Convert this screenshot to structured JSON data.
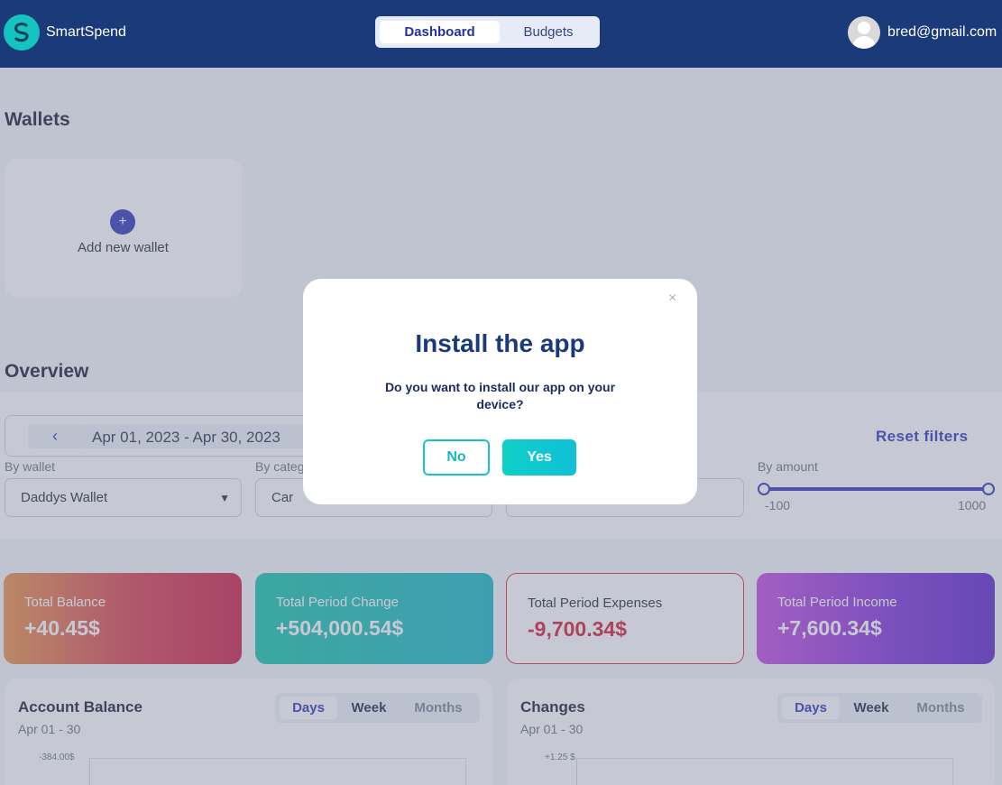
{
  "header": {
    "brand": "SmartSpend",
    "tabs": [
      {
        "label": "Dashboard",
        "active": true
      },
      {
        "label": "Budgets",
        "active": false
      }
    ],
    "user_email": "bred@gmail.com",
    "logo_icon": "s-logo-icon",
    "avatar_icon": "user-avatar-icon"
  },
  "wallets": {
    "title": "Wallets",
    "add_label": "Add new wallet",
    "add_icon": "plus-icon"
  },
  "overview": {
    "title": "Overview",
    "date_range": "Apr 01, 2023 - Apr 30, 2023",
    "prev_icon": "chevron-left-icon",
    "reset_label": "Reset filters",
    "filters": {
      "wallet_label": "By wallet",
      "wallet_value": "Daddys Wallet",
      "category_label": "By categ",
      "category_value": "Car",
      "amount_label": "By amount",
      "amount_min": "-100",
      "amount_max": "1000"
    }
  },
  "stats": [
    {
      "label": "Total Balance",
      "value": "+40.45$"
    },
    {
      "label": "Total Period Change",
      "value": "+504,000.54$"
    },
    {
      "label": "Total Period Expenses",
      "value": "-9,700.34$"
    },
    {
      "label": "Total Period Income",
      "value": "+7,600.34$"
    }
  ],
  "panels": [
    {
      "title": "Account Balance",
      "subtitle": "Apr 01 - 30",
      "periods": [
        "Days",
        "Week",
        "Months"
      ],
      "first_tick": "-384.00$"
    },
    {
      "title": "Changes",
      "subtitle": "Apr 01 - 30",
      "periods": [
        "Days",
        "Week",
        "Months"
      ],
      "first_tick": "+1.25 $"
    }
  ],
  "modal": {
    "close": "×",
    "title": "Install the app",
    "body": "Do you want to install our app on your device?",
    "no_label": "No",
    "yes_label": "Yes"
  },
  "colors": {
    "header_bg": "#1b3a7a",
    "accent": "#2c33b5",
    "teal": "#16c6c3",
    "expense_red": "#d5192f"
  }
}
